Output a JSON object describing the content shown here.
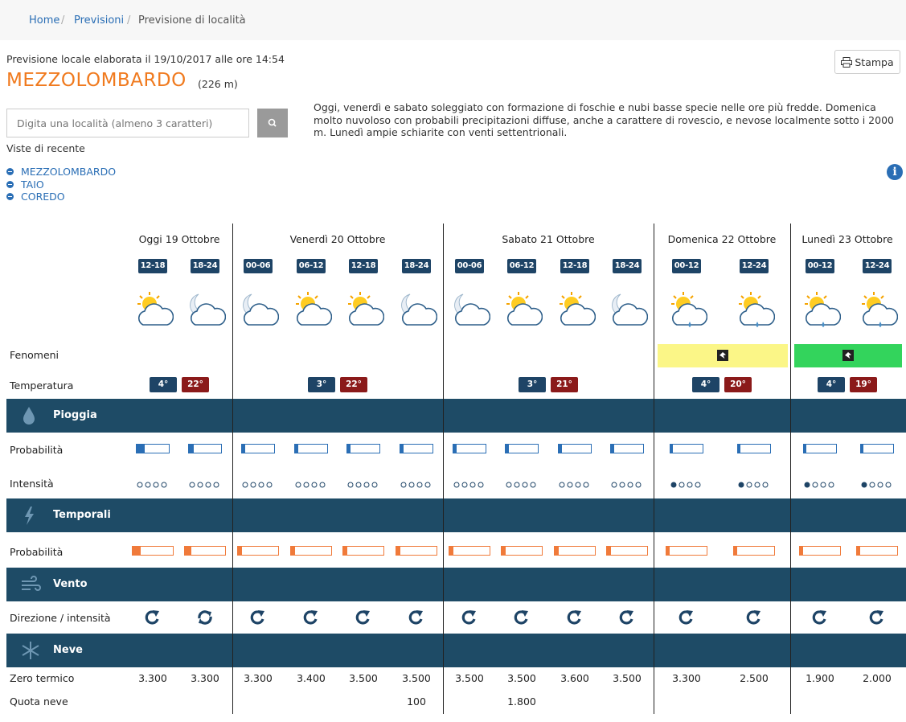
{
  "breadcrumb": {
    "home": "Home",
    "sep1": "/",
    "previsioni": "Previsioni",
    "sep2": "/",
    "current": "Previsione di località"
  },
  "header": {
    "elaborated": "Previsione locale elaborata il 19/10/2017 alle ore 14:54",
    "city": "MEZZOLOMBARDO",
    "altitude": "(226 m)",
    "print_label": "Stampa"
  },
  "search": {
    "placeholder": "Digita una località (almeno 3 caratteri)"
  },
  "recent": {
    "title": "Viste di recente",
    "items": [
      "MEZZOLOMBARDO",
      "TAIO",
      "COREDO"
    ]
  },
  "description": "Oggi, venerdì e sabato soleggiato con formazione di foschie e nubi basse specie nelle ore più fredde. Domenica molto nuvoloso con probabili precipitazioni diffuse, anche a carattere di rovescio, e nevose localmente sotto i 2000 m. Lunedì ampie schiarite con venti settentrionali.",
  "days": [
    {
      "label": "Oggi 19 Ottobre",
      "tmin": "4°",
      "tmax": "22°",
      "fenomeni": null
    },
    {
      "label": "Venerdì 20 Ottobre",
      "tmin": "3°",
      "tmax": "22°",
      "fenomeni": null
    },
    {
      "label": "Sabato 21 Ottobre",
      "tmin": "3°",
      "tmax": "21°",
      "fenomeni": null
    },
    {
      "label": "Domenica 22 Ottobre",
      "tmin": "4°",
      "tmax": "20°",
      "fenomeni": "#fbf687"
    },
    {
      "label": "Lunedì 23 Ottobre",
      "tmin": "4°",
      "tmax": "19°",
      "fenomeni": "#33d45c"
    }
  ],
  "slots": [
    {
      "label": "12-18",
      "icon": "sun-behind-cloud-icon",
      "rain_prob": 0.25,
      "rain_drops": 0,
      "storm_prob": 0.2,
      "dir": "wind-direction-icon",
      "zero": "3.300",
      "quota": ""
    },
    {
      "label": "18-24",
      "icon": "moon-behind-cloud-icon",
      "rain_prob": 0.15,
      "rain_drops": 0,
      "storm_prob": 0.15,
      "dir": "wind-variable-icon",
      "zero": "3.300",
      "quota": ""
    },
    {
      "label": "00-06",
      "icon": "moon-behind-cloud-icon",
      "rain_prob": 0.1,
      "rain_drops": 0,
      "storm_prob": 0.1,
      "dir": "wind-direction-icon",
      "zero": "3.300",
      "quota": ""
    },
    {
      "label": "06-12",
      "icon": "sun-behind-cloud-icon",
      "rain_prob": 0.1,
      "rain_drops": 0,
      "storm_prob": 0.1,
      "dir": "wind-direction-icon",
      "zero": "3.400",
      "quota": ""
    },
    {
      "label": "12-18",
      "icon": "sun-behind-cloud-icon",
      "rain_prob": 0.1,
      "rain_drops": 0,
      "storm_prob": 0.1,
      "dir": "wind-direction-icon",
      "zero": "3.500",
      "quota": ""
    },
    {
      "label": "18-24",
      "icon": "moon-behind-cloud-icon",
      "rain_prob": 0.1,
      "rain_drops": 0,
      "storm_prob": 0.1,
      "dir": "wind-direction-icon",
      "zero": "3.500",
      "quota": "100"
    },
    {
      "label": "00-06",
      "icon": "moon-behind-cloud-icon",
      "rain_prob": 0.1,
      "rain_drops": 0,
      "storm_prob": 0.1,
      "dir": "wind-direction-icon",
      "zero": "3.500",
      "quota": ""
    },
    {
      "label": "06-12",
      "icon": "sun-behind-cloud-icon",
      "rain_prob": 0.1,
      "rain_drops": 0,
      "storm_prob": 0.1,
      "dir": "wind-direction-icon",
      "zero": "3.500",
      "quota": "1.800"
    },
    {
      "label": "12-18",
      "icon": "sun-behind-cloud-icon",
      "rain_prob": 0.1,
      "rain_drops": 0,
      "storm_prob": 0.1,
      "dir": "wind-direction-icon",
      "zero": "3.600",
      "quota": ""
    },
    {
      "label": "18-24",
      "icon": "moon-behind-cloud-icon",
      "rain_prob": 0.1,
      "rain_drops": 0,
      "storm_prob": 0.1,
      "dir": "wind-direction-icon",
      "zero": "3.500",
      "quota": ""
    },
    {
      "label": "00-12",
      "icon": "sun-cloud-rain-icon",
      "rain_prob": 0.08,
      "rain_drops": 1,
      "storm_prob": 0.08,
      "dir": "wind-direction-icon",
      "zero": "3.300",
      "quota": ""
    },
    {
      "label": "12-24",
      "icon": "sun-cloud-rain-icon",
      "rain_prob": 0.08,
      "rain_drops": 1,
      "storm_prob": 0.08,
      "dir": "wind-direction-icon",
      "zero": "2.500",
      "quota": ""
    },
    {
      "label": "00-12",
      "icon": "sun-cloud-rain-icon",
      "rain_prob": 0.08,
      "rain_drops": 1,
      "storm_prob": 0.08,
      "dir": "wind-direction-icon",
      "zero": "1.900",
      "quota": ""
    },
    {
      "label": "12-24",
      "icon": "sun-cloud-rain-icon",
      "rain_prob": 0.08,
      "rain_drops": 1,
      "storm_prob": 0.08,
      "dir": "wind-direction-icon",
      "zero": "2.000",
      "quota": ""
    }
  ],
  "rows": {
    "fenomeni": "Fenomeni",
    "temperatura": "Temperatura",
    "pioggia": "Pioggia",
    "probabilita": "Probabilità",
    "intensita": "Intensità",
    "temporali": "Temporali",
    "probabilita2": "Probabilità",
    "vento": "Vento",
    "direzione": "Direzione / intensità",
    "neve": "Neve",
    "zero": "Zero termico",
    "quota": "Quota neve"
  },
  "colors": {
    "band": "#1e4b66",
    "slot": "#1e4466",
    "tmax": "#8b1a1a",
    "rain_bar": "#2a6eb5",
    "storm_bar": "#f07a3a",
    "accent": "#f07a1e"
  }
}
